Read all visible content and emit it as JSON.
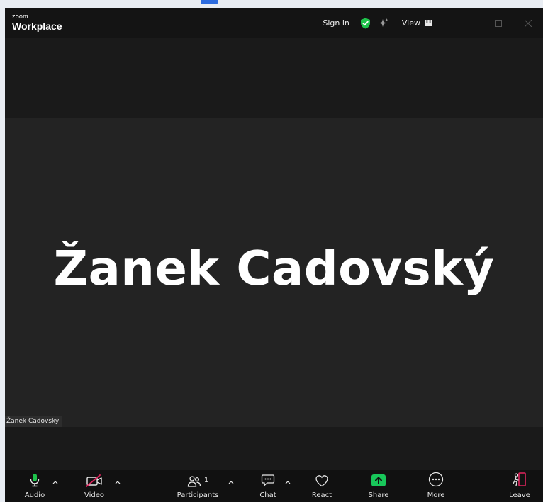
{
  "brand": {
    "top": "zoom",
    "main": "Workplace"
  },
  "titlebar": {
    "sign_in": "Sign in",
    "view": "View",
    "icons": [
      "shield-check-icon",
      "sparkle-icon",
      "grid-view-icon",
      "minimize-icon",
      "maximize-icon",
      "close-icon"
    ]
  },
  "participant": {
    "display_name": "Žanek Cadovský",
    "name_tag": "Žanek Cadovský"
  },
  "toolbar": {
    "audio": "Audio",
    "video": "Video",
    "participants": "Participants",
    "participants_count": "1",
    "chat": "Chat",
    "react": "React",
    "share": "Share",
    "more": "More",
    "leave": "Leave"
  },
  "colors": {
    "accent_green": "#1ec34b",
    "share_green": "#18c75a",
    "video_off_red": "#e0245e",
    "leave_red": "#e0245e"
  }
}
